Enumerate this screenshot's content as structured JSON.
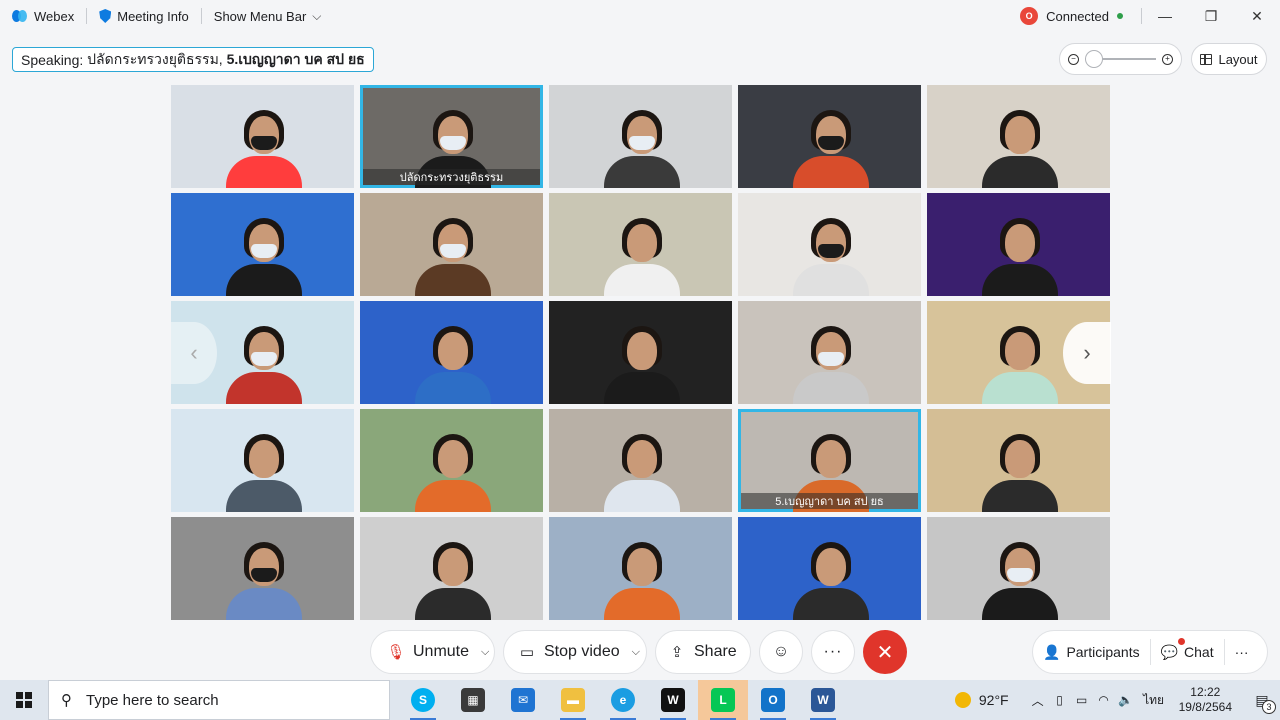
{
  "titlebar": {
    "app_name": "Webex",
    "meeting_info": "Meeting Info",
    "show_menu_bar": "Show Menu Bar",
    "status": "Connected",
    "status_badge": "O"
  },
  "speaking": {
    "prefix": "Speaking:",
    "first": "ปลัดกระทรวงยุติธรรม,",
    "second": "5.เบญญาดา บค สป ยธ"
  },
  "layout_label": "Layout",
  "tiles": [
    {
      "label": ""
    },
    {
      "label": "ปลัดกระทรวงยุติธรรม"
    },
    {
      "label": ""
    },
    {
      "label": ""
    },
    {
      "label": ""
    },
    {
      "label": ""
    },
    {
      "label": ""
    },
    {
      "label": ""
    },
    {
      "label": ""
    },
    {
      "label": ""
    },
    {
      "label": ""
    },
    {
      "label": ""
    },
    {
      "label": ""
    },
    {
      "label": ""
    },
    {
      "label": ""
    },
    {
      "label": ""
    },
    {
      "label": ""
    },
    {
      "label": ""
    },
    {
      "label": "5.เบญญาดา บค สป ยธ"
    },
    {
      "label": ""
    },
    {
      "label": ""
    },
    {
      "label": ""
    },
    {
      "label": ""
    },
    {
      "label": ""
    },
    {
      "label": ""
    }
  ],
  "controls": {
    "unmute": "Unmute",
    "stop_video": "Stop video",
    "share": "Share",
    "more": "···",
    "participants": "Participants",
    "chat": "Chat"
  },
  "taskbar": {
    "search_placeholder": "Type here to search",
    "temperature": "92°F",
    "language": "ไทย",
    "time": "12:22",
    "date": "19/8/2564",
    "notification_count": "3"
  },
  "colors": {
    "active_tile": "#32b6e6",
    "end_call": "#e0352b",
    "accent": "#0e7be0"
  }
}
